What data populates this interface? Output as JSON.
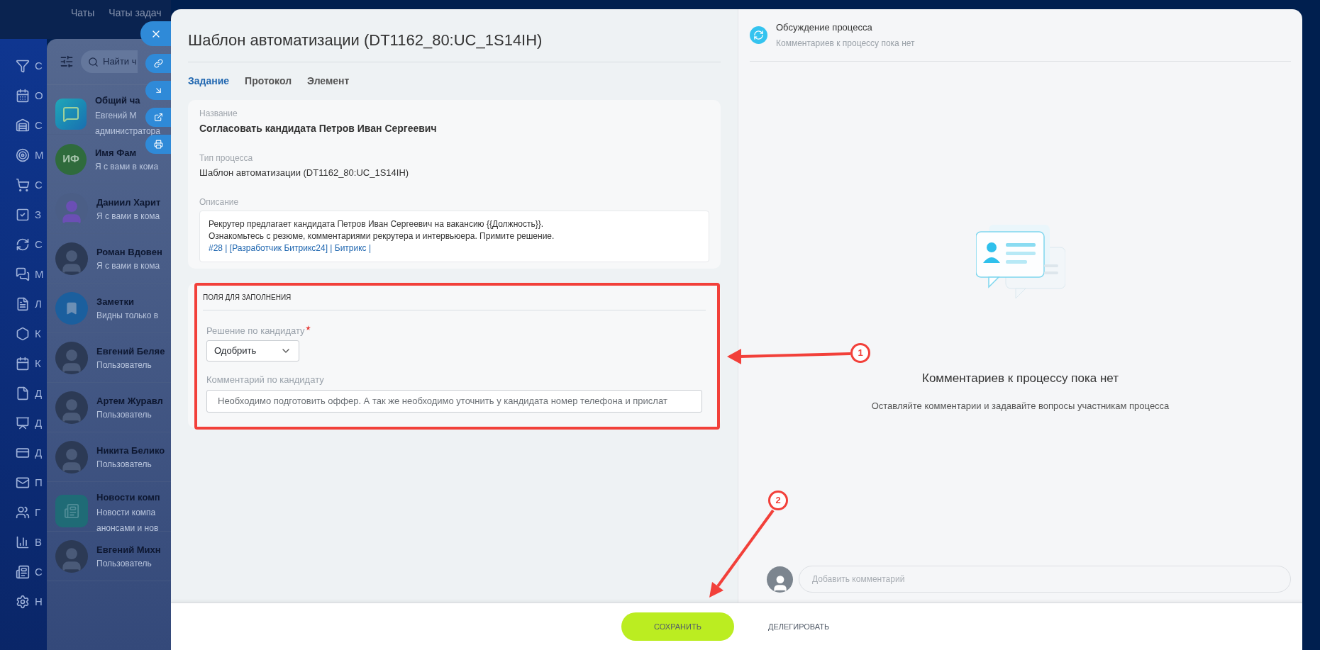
{
  "top_nav": {
    "items": [
      {
        "label": "Чаты"
      },
      {
        "label": "Чаты задач"
      }
    ]
  },
  "left_menu": {
    "items": [
      "С",
      "О",
      "С",
      "М",
      "С",
      "З",
      "С",
      "М",
      "Л",
      "К",
      "К",
      "Д",
      "Д",
      "Д",
      "П",
      "Г",
      "В",
      "С",
      "Н"
    ]
  },
  "chat_list": {
    "search": {
      "placeholder": "Найти ч"
    },
    "chats": [
      {
        "name": "Общий ча",
        "preview": [
          "Евгений М",
          "администратора"
        ],
        "avatar": {
          "kind": "app"
        }
      },
      {
        "name": "Имя Фам",
        "preview": [
          "Я с вами в кома"
        ],
        "avatar": {
          "kind": "initials",
          "initials": "ИФ"
        }
      },
      {
        "name": "Даниил Харит",
        "preview": [
          "Я с вами в кома"
        ],
        "avatar": {
          "kind": "silhouette"
        }
      },
      {
        "name": "Роман Вдовен",
        "preview": [
          "Я с вами в кома"
        ],
        "avatar": {
          "kind": "photo"
        }
      },
      {
        "name": "Заметки",
        "preview": [
          "Видны только в"
        ],
        "avatar": {
          "kind": "notes"
        }
      },
      {
        "name": "Евгений Беляе",
        "preview": [
          "Пользователь"
        ],
        "avatar": {
          "kind": "photo"
        }
      },
      {
        "name": "Артем Журавл",
        "preview": [
          "Пользователь"
        ],
        "avatar": {
          "kind": "photo"
        }
      },
      {
        "name": "Никита Белико",
        "preview": [
          "Пользователь"
        ],
        "avatar": {
          "kind": "photo"
        }
      },
      {
        "name": "Новости комп",
        "preview": [
          "Новости компа",
          "анонсами и нов"
        ],
        "avatar": {
          "kind": "news"
        }
      },
      {
        "name": "Евгений Михн",
        "preview": [
          "Пользователь"
        ],
        "avatar": {
          "kind": "photo"
        }
      }
    ]
  },
  "slider": {
    "title": "Шаблон автоматизации (DT1162_80:UC_1S14IH)",
    "tabs": [
      {
        "label": "Задание",
        "selected": true
      },
      {
        "label": "Протокол",
        "selected": false
      },
      {
        "label": "Элемент",
        "selected": false
      }
    ],
    "details": {
      "name_label": "Название",
      "name": "Согласовать кандидата Петров Иван Сергеевич",
      "type_label": "Тип процесса",
      "type": "Шаблон автоматизации (DT1162_80:UC_1S14IH)",
      "description_label": "Описание",
      "description": [
        "Рекрутер предлагает кандидата Петров Иван Сергеевич на вакансию {{Должность}}.",
        "Ознакомьтесь с резюме, комментариями рекрутера и интервьюера. Примите решение."
      ],
      "description_link": "#28 | [Разработчик Битрикс24] | Битрикс |"
    },
    "fields_section": {
      "heading": "ПОЛЯ ДЛЯ ЗАПОЛНЕНИЯ",
      "fields": [
        {
          "kind": "select",
          "label": "Решение по кандидату",
          "required": true,
          "value": "Одобрить"
        },
        {
          "kind": "text",
          "label": "Комментарий по кандидату",
          "required": false,
          "value": "Необходимо подготовить оффер. А так же необходимо уточнить у кандидата номер телефона и прислат"
        }
      ]
    },
    "discussion": {
      "title": "Обсуждение процесса",
      "subtitle": "Комментариев к процессу пока нет",
      "empty_title": "Комментариев к процессу пока нет",
      "empty_text": "Оставляйте комментарии и задавайте вопросы участникам процесса",
      "comment": {
        "placeholder": "Добавить комментарий"
      }
    },
    "footer": {
      "buttons": [
        {
          "label": "СОХРАНИТЬ",
          "kind": "primary"
        },
        {
          "label": "ДЕЛЕГИРОВАТЬ",
          "kind": "link"
        }
      ]
    }
  },
  "annotations": [
    {
      "label": "1"
    },
    {
      "label": "2"
    }
  ]
}
